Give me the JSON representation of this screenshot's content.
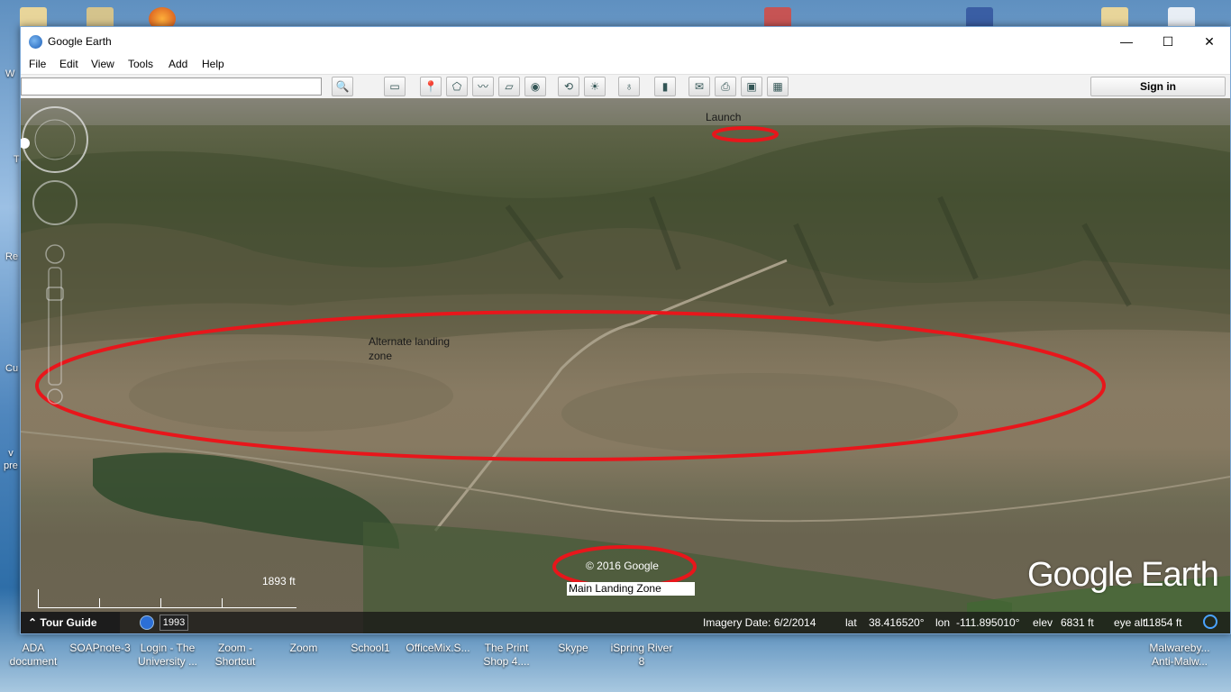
{
  "window": {
    "title": "Google Earth",
    "controls": {
      "minimize": "—",
      "maximize": "☐",
      "close": "✕"
    }
  },
  "menu": [
    "File",
    "Edit",
    "View",
    "Tools",
    "Add",
    "Help"
  ],
  "search": {
    "value": "",
    "placeholder": ""
  },
  "toolbar": {
    "icons": [
      "search-icon",
      "sidebar-icon",
      "placemark-icon",
      "polygon-icon",
      "path-icon",
      "image-overlay-icon",
      "record-tour-icon",
      "historical-imagery-icon",
      "sunlight-icon",
      "planets-icon",
      "ruler-icon",
      "email-icon",
      "print-icon",
      "save-image-icon",
      "view-in-maps-icon"
    ],
    "sign_in": "Sign in"
  },
  "map": {
    "annotations": {
      "launch": "Launch",
      "alternate": "Alternate landing\nzone",
      "main": "Main Landing Zone"
    },
    "copyright": "© 2016 Google",
    "logo": "Google Earth",
    "scale": "1893 ft",
    "circle_color": "#e8161b"
  },
  "status": {
    "tour_guide": "Tour Guide",
    "year": "1993",
    "imagery_date": "Imagery Date: 6/2/2014",
    "lat_label": "lat",
    "lat": "38.416520°",
    "lon_label": "lon",
    "lon": "-111.895010°",
    "elev_label": "elev",
    "elev": "6831 ft",
    "eye_alt_label": "eye alt",
    "eye_alt": "11854 ft"
  },
  "desktop": {
    "taskbar_icons": [
      {
        "label": "ADA\ndocument"
      },
      {
        "label": "SOAPnote-3"
      },
      {
        "label": "Login - The\nUniversity ..."
      },
      {
        "label": "Zoom -\nShortcut"
      },
      {
        "label": "Zoom"
      },
      {
        "label": "School1"
      },
      {
        "label": "OfficeMix.S..."
      },
      {
        "label": "The Print\nShop 4...."
      },
      {
        "label": "Skype"
      },
      {
        "label": "iSpring River\n8"
      },
      {
        "label": "Malwareby...\nAnti-Malw..."
      }
    ],
    "left_edge_labels": [
      "W",
      "T",
      "Re",
      "Cu",
      "v\npre"
    ]
  }
}
